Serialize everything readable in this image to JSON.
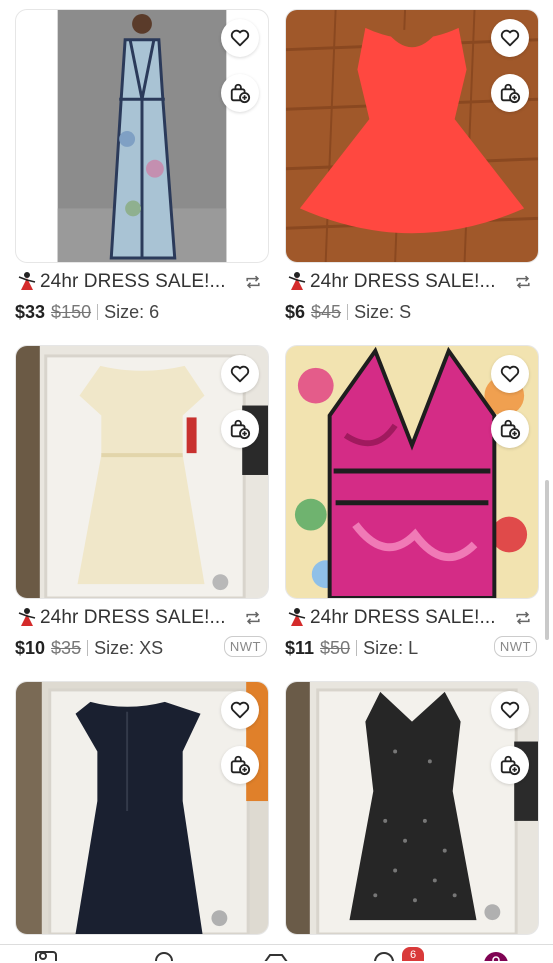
{
  "listings": [
    {
      "seller": "24hr DRESS SALE!...",
      "price": "$33",
      "original_price": "$150",
      "size": "Size: 6",
      "badge": "",
      "image_desc_icon": "maxi-dress-photo",
      "colors": {
        "bg": "#8a8a8a",
        "dress": "#9fb7c8"
      }
    },
    {
      "seller": "24hr DRESS SALE!...",
      "price": "$6",
      "original_price": "$45",
      "size": "Size: S",
      "badge": "",
      "image_desc_icon": "coral-dress-photo",
      "colors": {
        "bg": "#a35b2e",
        "dress": "#ff4a42"
      }
    },
    {
      "seller": "24hr DRESS SALE!...",
      "price": "$10",
      "original_price": "$35",
      "size": "Size: XS",
      "badge": "NWT",
      "image_desc_icon": "lace-dress-photo",
      "colors": {
        "bg": "#e8e4dc",
        "dress": "#efe6c8"
      }
    },
    {
      "seller": "24hr DRESS SALE!...",
      "price": "$11",
      "original_price": "$50",
      "size": "Size: L",
      "badge": "NWT",
      "image_desc_icon": "floral-dress-photo",
      "colors": {
        "bg": "#f0e2b0",
        "dress": "#d42c86"
      }
    },
    {
      "seller": "",
      "price": "",
      "original_price": "",
      "size": "",
      "badge": "",
      "image_desc_icon": "navy-dress-photo",
      "colors": {
        "bg": "#dcd8cf",
        "dress": "#1b2130"
      }
    },
    {
      "seller": "",
      "price": "",
      "original_price": "",
      "size": "",
      "badge": "",
      "image_desc_icon": "polka-dot-dress-photo",
      "colors": {
        "bg": "#e6e3dc",
        "dress": "#252525"
      }
    }
  ],
  "icons": {
    "like": "heart-icon",
    "bundle": "bag-plus-icon",
    "share": "share-arrows-icon",
    "seller": "dancer-icon"
  },
  "nav": {
    "badge": "6",
    "accent": "#7f0353"
  }
}
